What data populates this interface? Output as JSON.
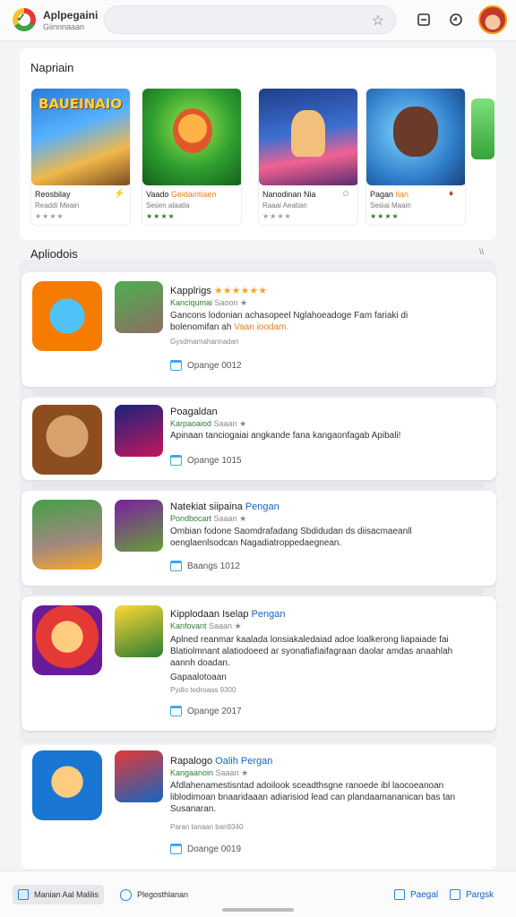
{
  "header": {
    "app_title": "Aplpegaini",
    "app_subtitle": "Giinnnaaan",
    "search_icon": "star-icon",
    "icons": [
      "save-icon",
      "clock-icon"
    ]
  },
  "featured": {
    "title": "Napriain",
    "items": [
      {
        "name": "Reosbilay",
        "name_hl": "",
        "sub": "Readdi Meain",
        "stars": "★★★★",
        "star_color": "#9e9e9e",
        "art_text": "BAUEINAIO"
      },
      {
        "name": "Vaado ",
        "name_hl": "Geidaintiaen",
        "sub": "Sesen alaatla",
        "stars": "★★★★",
        "star_color": "#2e7d32",
        "art_text": ""
      },
      {
        "name": "Nanodinan Nia",
        "name_hl": "",
        "sub": "Raaai Aeatian",
        "stars": "★★★★",
        "star_color": "#9e9e9e",
        "art_text": ""
      },
      {
        "name": "Pagan ",
        "name_hl": "Iian",
        "sub": "Sesiai Maain",
        "stars": "★★★★",
        "star_color": "#2e7d32",
        "art_text": ""
      }
    ]
  },
  "list": {
    "title": "Apliodois",
    "more": "\\\\",
    "items": [
      {
        "title": "Kapplrigs ",
        "title_acc": "",
        "stars": "★★★★★★",
        "sub": "Kanciqumai",
        "sub_grey": " Saoon ★",
        "desc": "Gancons lodonian achasopeel Nglahoeadoge Fam fariaki di bolenomifan ah",
        "desc_hl": "Vaan ioodam.",
        "extra": "",
        "meta": "Gysdmamahannadan",
        "date": "Opange 0012"
      },
      {
        "title": "Poagaldan",
        "title_acc": "",
        "stars": "",
        "sub": "Karpaoaiod",
        "sub_grey": " Saaan ★",
        "desc": "Apinaan tanciogaiai angkande fana kangaonfagab Apibali!",
        "desc_hl": "",
        "extra": "",
        "meta": "",
        "date": "Opange 1015"
      },
      {
        "title": "Natekiat siipaina ",
        "title_acc": "Pengan",
        "stars": "",
        "sub": "Pondbocart",
        "sub_grey": " Saaan ★",
        "desc": "Ombian fodone Saomdrafadang Sbdidudan ds diisacmaeanll oenglaenlsodcan Nagadiatroppedaegnean.",
        "desc_hl": "",
        "extra": "",
        "meta": "",
        "date": "Baangs 1012"
      },
      {
        "title": "Kipplodaan Iselap",
        "title_acc": "Pengan",
        "stars": "",
        "sub": "Kanfovant",
        "sub_grey": " Saaan ★",
        "desc": "Aplned reanmar kaalada lonsiakaledaiad adoe loalkerong liapaiade fai Blatiolmnant alatiodoeed ar syonafiafiaifagraan daolar amdas anaahlah aannh doadan.",
        "desc_hl": "",
        "extra": "Gapaalotoaan",
        "meta": "Pydio tedroaas 9300",
        "date": "Opange 2017"
      },
      {
        "title": "Rapalogo ",
        "title_acc": "Oalih Pergan",
        "stars": "",
        "sub": "Kangaanoin",
        "sub_grey": " Saaan ★",
        "desc": "Afdlahenamestisntad adoilook sceadthsgne ranoede ibl laocoeanoan liblodimoan bnaaridaaan adiarisiod lead can plandaamananican bas tan Susanaran.",
        "desc_hl": "",
        "extra": "",
        "meta": "Paran tanaan ban9340",
        "date": "Doange 0019"
      }
    ]
  },
  "bottombar": {
    "left_tab": "Manian Aal Malilis",
    "center_tab": "Plegosthlanan",
    "right_tab_1": "Paegal",
    "right_tab_2": "Pargsk"
  }
}
